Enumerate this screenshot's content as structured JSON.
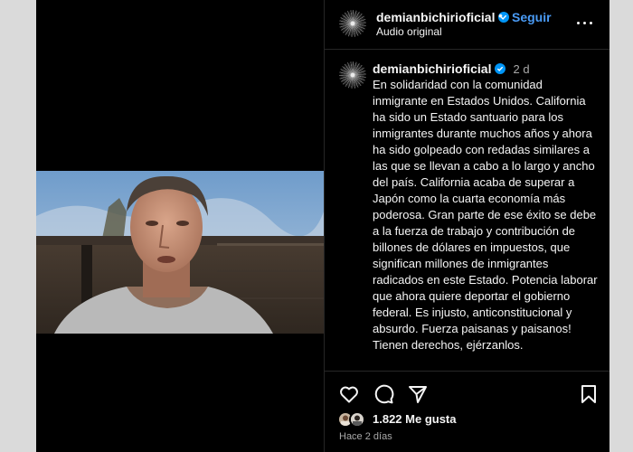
{
  "header": {
    "username": "demianbichirioficial",
    "separator": "•",
    "follow_label": "Seguir",
    "audio_label": "Audio original",
    "avatar_icon": "galaxy-avatar-icon",
    "more_icon": "more-options-icon"
  },
  "caption": {
    "username": "demianbichirioficial",
    "time": "2 d",
    "text": "En solidaridad con la comunidad inmigrante en Estados Unidos. California ha sido un Estado santuario para los inmigrantes durante muchos años y ahora ha sido golpeado con redadas similares a las que se llevan a cabo a lo largo y ancho del país. California acaba de superar a Japón como la cuarta economía más poderosa. Gran parte de ese éxito se debe a la fuerza de trabajo y contribución de billones de dólares en impuestos, que significan millones de inmigrantes radicados en este Estado. Potencia laborar que ahora quiere deportar el gobierno federal. Es injusto, anticonstitucional y absurdo. Fuerza paisanas y paisanos! Tienen derechos, ejérzanlos."
  },
  "actions": {
    "icons": [
      "heart-icon",
      "comment-icon",
      "share-icon",
      "bookmark-icon"
    ]
  },
  "likes": {
    "count_label": "1.822 Me gusta"
  },
  "post_time": "Hace 2 días",
  "colors": {
    "background": "#000000",
    "link": "#4a9bf5",
    "verified": "#0095f6",
    "muted": "#a8a8a8"
  }
}
